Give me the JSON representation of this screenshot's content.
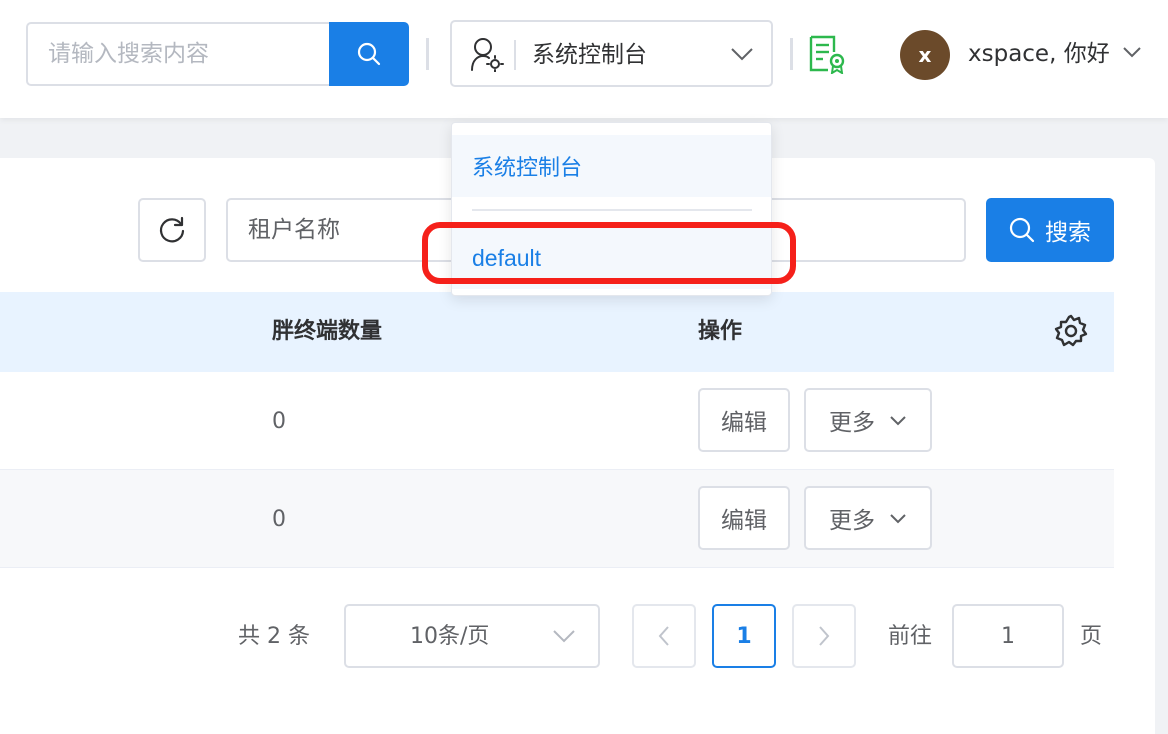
{
  "header": {
    "search_placeholder": "请输入搜索内容",
    "role_value": "系统控制台",
    "user_initial": "x",
    "user_name": "xspace, 你好",
    "icons": [
      "search-icon",
      "user-gear-icon",
      "chevron-down-icon",
      "license-certificate-icon"
    ]
  },
  "toolbar": {
    "tenant_placeholder": "租户名称",
    "search_label": "搜索"
  },
  "table": {
    "columns": [
      "胖终端数量",
      "操作"
    ],
    "rows": [
      {
        "count": "0",
        "edit": "编辑",
        "more": "更多"
      },
      {
        "count": "0",
        "edit": "编辑",
        "more": "更多"
      }
    ]
  },
  "pagination": {
    "total": "共 2 条",
    "page_size": "10条/页",
    "current_page": "1",
    "goto_label": "前往",
    "goto_value": "1",
    "page_suffix": "页"
  },
  "dropdown": {
    "items": [
      "系统控制台",
      "default"
    ]
  },
  "colors": {
    "primary": "#1a7fe6",
    "highlight": "#f5201a",
    "license_green": "#2db84d",
    "table_header_bg": "#e8f3ff"
  }
}
